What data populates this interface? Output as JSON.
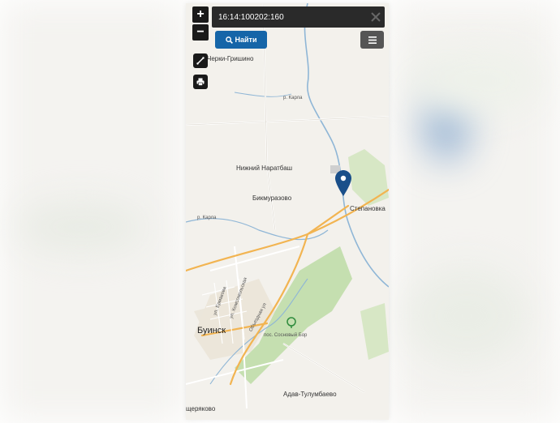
{
  "search": {
    "value": "16:14:100202:160",
    "find_label": "Найти"
  },
  "controls": {
    "zoom_in": "+",
    "zoom_out": "−"
  },
  "places": {
    "cherki_grishino": "Черки-Гришино",
    "nizhny_naratbash": "Нижний Наратбаш",
    "bikmurazovo": "Бикмуразово",
    "stepanovka": "Степановка",
    "buinsk": "Буинск",
    "sosnovy_bor": "пос. Сосновый Бор",
    "adav_tulumbaevo": "Адав-Тулумбаево",
    "scheryakovo": "щеряково"
  },
  "roads": {
    "r1": "р. Карла",
    "r2": "р. Карла",
    "street_ermakova": "ул. Ермакова",
    "street_komsomolskaya": "ул. Комсомольская",
    "street_obezdnaya": "Объездная ул"
  },
  "colors": {
    "control_dark": "#1a1a1a",
    "find_button": "#1565a8",
    "pin": "#1a4f8a",
    "forest": "#b8d9a0",
    "water": "#8fb6d6",
    "road_major": "#f2b451"
  },
  "icons": {
    "search": "search-icon",
    "close": "close-icon",
    "menu": "menu-icon",
    "measure": "ruler-icon",
    "print": "print-icon",
    "pin": "map-pin-icon",
    "park": "park-icon"
  }
}
